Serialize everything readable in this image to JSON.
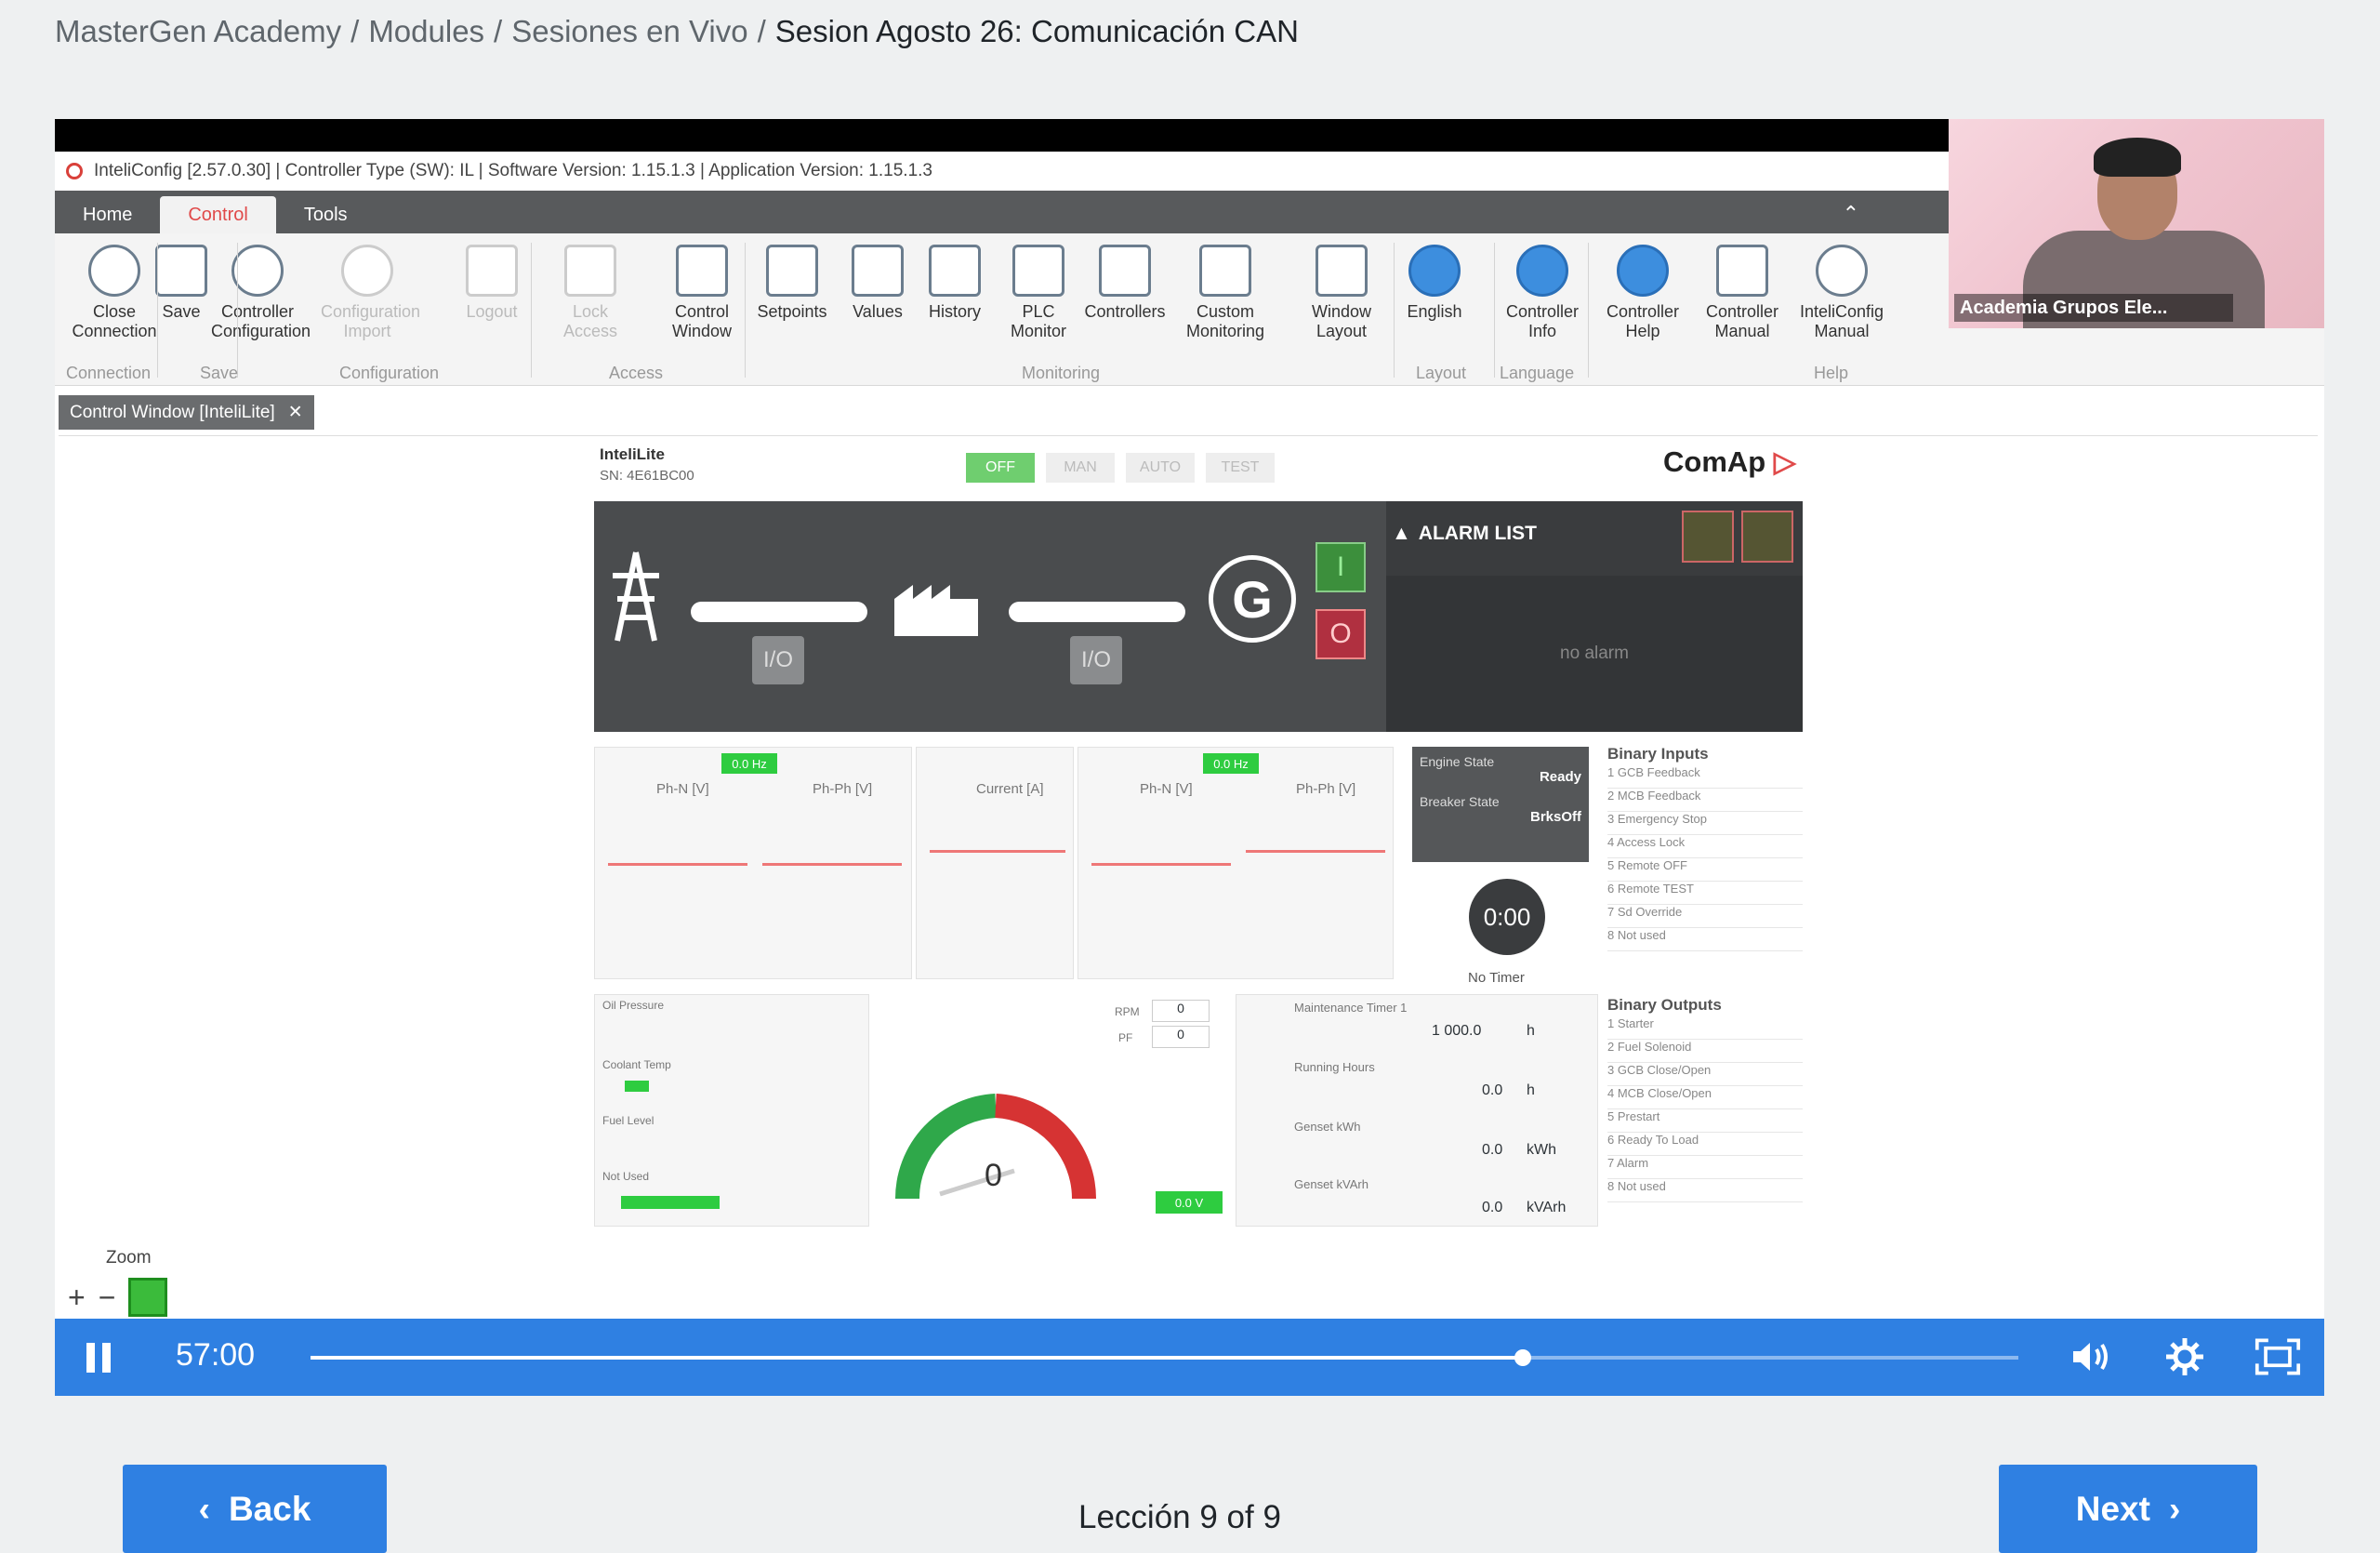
{
  "breadcrumb": {
    "items": [
      "MasterGen Academy",
      "Modules",
      "Sesiones en Vivo"
    ],
    "separator": "/",
    "current": "Sesion Agosto 26: Comunicación CAN"
  },
  "video": {
    "inteliconfig": {
      "title_bar": "InteliConfig [2.57.0.30]  |  Controller Type (SW): IL  |  Software Version: 1.15.1.3  |  Application Version: 1.15.1.3",
      "tabs": [
        "Home",
        "Control",
        "Tools"
      ],
      "active_tab": "Control",
      "ribbon": {
        "items": [
          "Close Connection",
          "Save",
          "Controller Configuration",
          "Configuration Import",
          "Logout",
          "Lock Access",
          "Control Window",
          "Setpoints",
          "Values",
          "History",
          "PLC Monitor",
          "Controllers",
          "Custom Monitoring",
          "Window Layout",
          "English",
          "Controller Info",
          "Controller Help",
          "Controller Manual",
          "InteliConfig Manual"
        ],
        "groups": [
          "Connection",
          "Save",
          "Configuration",
          "Access",
          "Monitoring",
          "Layout",
          "Language",
          "Help"
        ]
      },
      "doc_tab": "Control Window [InteliLite]",
      "controller": {
        "name": "InteliLite",
        "serial": "SN: 4E61BC00",
        "modes": [
          "OFF",
          "MAN",
          "AUTO",
          "TEST"
        ],
        "active_mode": "OFF",
        "brand": "ComAp",
        "io_label": "I/O",
        "gen_label": "G",
        "close_label": "I",
        "open_label": "O",
        "alarm_title": "ALARM LIST",
        "alarm_empty": "no alarm",
        "meter_labels": [
          "Ph-N [V]",
          "Ph-Ph [V]",
          "Current [A]",
          "Ph-N [V]",
          "Ph-Ph [V]"
        ],
        "freq_badge": "0.0 Hz",
        "engine_state_label": "Engine State",
        "engine_state": "Ready",
        "breaker_state_label": "Breaker State",
        "breaker_state": "BrksOff",
        "timer": "0:00",
        "timer_label": "No Timer",
        "binary_inputs_title": "Binary Inputs",
        "binary_inputs": [
          "1  GCB Feedback",
          "2  MCB Feedback",
          "3  Emergency Stop",
          "4  Access Lock",
          "5  Remote OFF",
          "6  Remote TEST",
          "7  Sd Override",
          "8  Not used"
        ],
        "binary_outputs_title": "Binary Outputs",
        "binary_outputs": [
          "1  Starter",
          "2  Fuel Solenoid",
          "3  GCB Close/Open",
          "4  MCB Close/Open",
          "5  Prestart",
          "6  Ready To Load",
          "7  Alarm",
          "8  Not used"
        ],
        "analog_labels": [
          "Oil Pressure",
          "Coolant Temp",
          "Fuel Level",
          "Not Used"
        ],
        "rpm_label": "RPM",
        "rpm_value": "0",
        "pf_label": "PF",
        "pf_value": "0",
        "gauge_value": "0",
        "battery_badge": "0.0 V",
        "counters": [
          {
            "label": "Maintenance Timer 1",
            "value": "1 000.0",
            "unit": "h"
          },
          {
            "label": "Running Hours",
            "value": "0.0",
            "unit": "h"
          },
          {
            "label": "Genset kWh",
            "value": "0.0",
            "unit": "kWh"
          },
          {
            "label": "Genset kVArh",
            "value": "0.0",
            "unit": "kVArh"
          }
        ]
      },
      "zoom_label": "Zoom",
      "zoom_in": "+",
      "zoom_out": "−"
    },
    "webcam_caption": "Academia Grupos Ele...",
    "player": {
      "time": "57:00",
      "progress": 0.71
    }
  },
  "footer": {
    "back_label": "Back",
    "next_label": "Next",
    "lesson_text": "Lección 9 of 9"
  },
  "colors": {
    "accent": "#2f80e2",
    "background": "#eef0f1"
  }
}
